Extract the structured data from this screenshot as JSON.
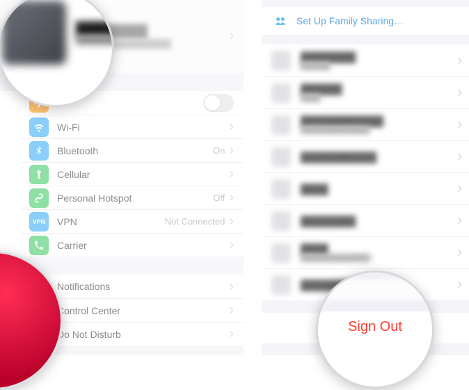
{
  "left": {
    "profile": {
      "name": "████████",
      "subtitle": "████████████████"
    },
    "groups": [
      {
        "rows": [
          {
            "id": "airplane",
            "label": "",
            "detail": "",
            "icon": "airplane",
            "color": "#ff9500",
            "toggle": true
          },
          {
            "id": "wifi",
            "label": "Wi-Fi",
            "detail": "",
            "icon": "wifi",
            "color": "#2aa7f6"
          },
          {
            "id": "bluetooth",
            "label": "Bluetooth",
            "detail": "On",
            "icon": "bluetooth",
            "color": "#2aa7f6"
          },
          {
            "id": "cellular",
            "label": "Cellular",
            "detail": "",
            "icon": "antenna",
            "color": "#34c759"
          },
          {
            "id": "hotspot",
            "label": "Personal Hotspot",
            "detail": "Off",
            "icon": "link",
            "color": "#34c759"
          },
          {
            "id": "vpn",
            "label": "VPN",
            "detail": "Not Connected",
            "icon": "vpn",
            "color": "#2aa7f6"
          },
          {
            "id": "carrier",
            "label": "Carrier",
            "detail": "",
            "icon": "phone",
            "color": "#34c759"
          }
        ]
      },
      {
        "rows": [
          {
            "id": "notifications",
            "label": "Notifications",
            "detail": "",
            "icon": "bell",
            "color": "#ff3b30"
          },
          {
            "id": "controlcenter",
            "label": "Control Center",
            "detail": "",
            "icon": "sliders",
            "color": "#8e8e93"
          },
          {
            "id": "dnd",
            "label": "Do Not Disturb",
            "detail": "",
            "icon": "moon",
            "color": "#5856d6"
          }
        ]
      }
    ]
  },
  "right": {
    "family_label": "Set Up Family Sharing…",
    "devices": [
      {
        "name": "████████",
        "sub": "██████"
      },
      {
        "name": "██████",
        "sub": "████"
      },
      {
        "name": "████████████",
        "sub": "██████████████"
      },
      {
        "name": "███████████",
        "sub": ""
      },
      {
        "name": "████",
        "sub": ""
      },
      {
        "name": "████████",
        "sub": ""
      },
      {
        "name": "████",
        "sub": "██████████████2"
      },
      {
        "name": "████████████",
        "sub": ""
      }
    ],
    "signout_label": "Sign Out"
  }
}
